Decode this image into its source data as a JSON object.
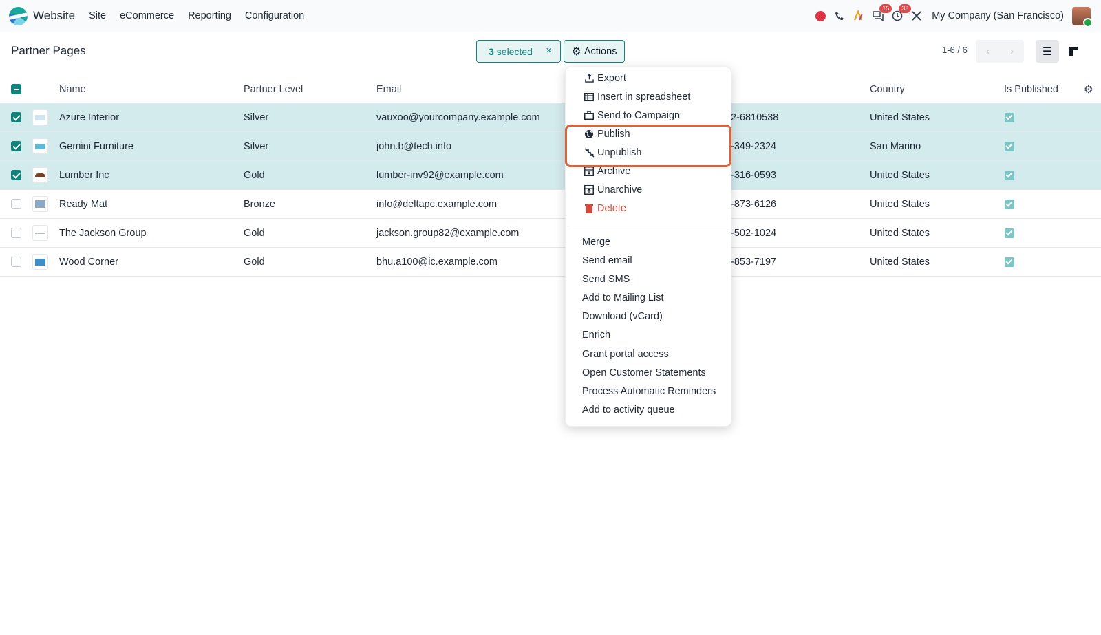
{
  "navbar": {
    "app_name": "Website",
    "menu": [
      "Site",
      "eCommerce",
      "Reporting",
      "Configuration"
    ],
    "messages_count": "15",
    "activities_count": "33",
    "company": "My Company (San Francisco)"
  },
  "control_panel": {
    "title": "Partner Pages",
    "selected_count": "3",
    "selected_label": "selected",
    "actions_label": "Actions",
    "pager": "1-6 / 6"
  },
  "table": {
    "columns": [
      "Name",
      "Partner Level",
      "Email",
      "Country",
      "Is Published"
    ],
    "rows": [
      {
        "name": "Azure Interior",
        "level": "Silver",
        "email": "vauxoo@yourcompany.example.com",
        "phone": "2-6810538",
        "country": "United States",
        "selected": true,
        "published": true
      },
      {
        "name": "Gemini Furniture",
        "level": "Silver",
        "email": "john.b@tech.info",
        "phone": "-349-2324",
        "country": "San Marino",
        "selected": true,
        "published": true
      },
      {
        "name": "Lumber Inc",
        "level": "Gold",
        "email": "lumber-inv92@example.com",
        "phone": "-316-0593",
        "country": "United States",
        "selected": true,
        "published": true
      },
      {
        "name": "Ready Mat",
        "level": "Bronze",
        "email": "info@deltapc.example.com",
        "phone": "-873-6126",
        "country": "United States",
        "selected": false,
        "published": true
      },
      {
        "name": "The Jackson Group",
        "level": "Gold",
        "email": "jackson.group82@example.com",
        "phone": "-502-1024",
        "country": "United States",
        "selected": false,
        "published": true
      },
      {
        "name": "Wood Corner",
        "level": "Gold",
        "email": "bhu.a100@ic.example.com",
        "phone": "-853-7197",
        "country": "United States",
        "selected": false,
        "published": true
      }
    ]
  },
  "actions_menu": {
    "items": [
      "Export",
      "Insert in spreadsheet",
      "Send to Campaign",
      "Publish",
      "Unpublish",
      "Archive",
      "Unarchive",
      "Delete"
    ],
    "more": [
      "Merge",
      "Send email",
      "Send SMS",
      "Add to Mailing List",
      "Download (vCard)",
      "Enrich",
      "Grant portal access",
      "Open Customer Statements",
      "Process Automatic Reminders",
      "Add to activity queue"
    ]
  },
  "colors": {
    "accent": "#10837d",
    "selected_row": "#d4ebee",
    "highlight": "#d9643a",
    "danger": "#d44c3f"
  }
}
